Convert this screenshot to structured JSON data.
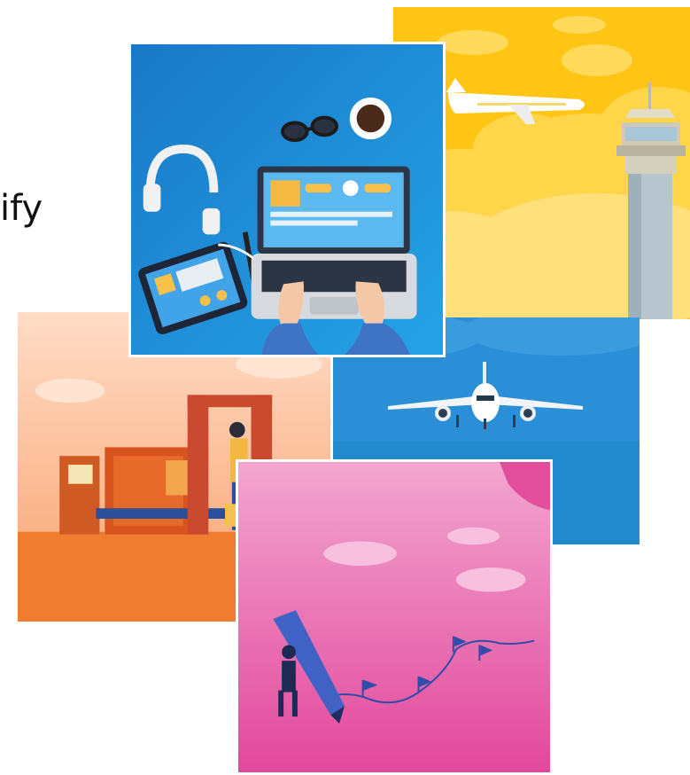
{
  "slide": {
    "text_fragment": "ify"
  },
  "illustrations": [
    {
      "id": "airport-tower",
      "bg": "#FFC514"
    },
    {
      "id": "laptop-desk",
      "bg": "#1E88D6"
    },
    {
      "id": "airplane-blue",
      "bg": "#2A8FD6"
    },
    {
      "id": "security-checkpoint",
      "bg": "#F08A4B"
    },
    {
      "id": "pencil-flags",
      "bg": "#E94FA3"
    }
  ]
}
